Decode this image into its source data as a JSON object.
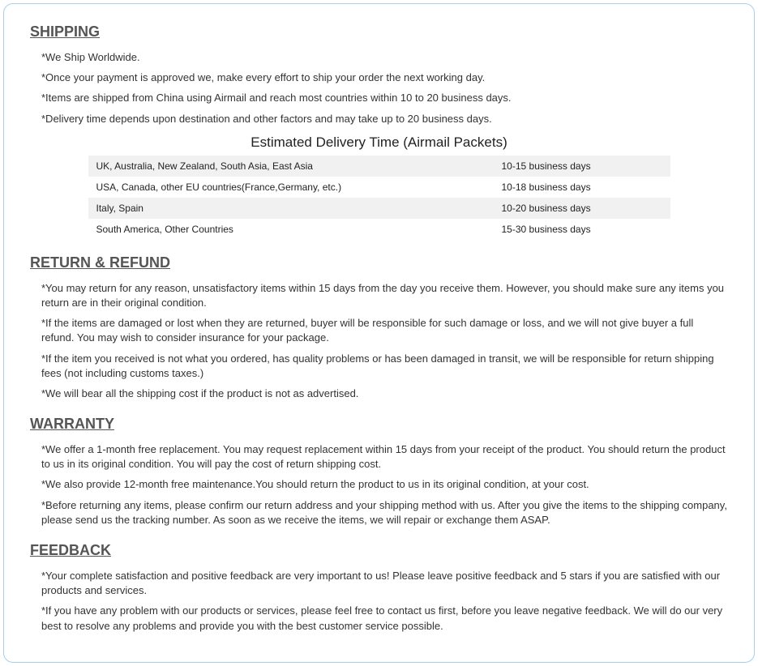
{
  "sections": {
    "shipping": {
      "title": "SHIPPING",
      "items": [
        "*We Ship Worldwide.",
        "*Once your payment is approved we, make every effort to ship your order the next working day.",
        "*Items are shipped from China using Airmail and reach most countries within 10 to 20 business days.",
        "*Delivery time depends upon destination and other factors and may take up to 20 business days."
      ],
      "table_title": "Estimated Delivery Time (Airmail Packets)",
      "table_rows": [
        {
          "region": "UK, Australia, New Zealand, South Asia, East Asia",
          "time": "10-15 business days"
        },
        {
          "region": "USA, Canada, other EU countries(France,Germany, etc.)",
          "time": "10-18 business days"
        },
        {
          "region": "Italy, Spain",
          "time": "10-20 business days"
        },
        {
          "region": "South America, Other Countries",
          "time": "15-30 business days"
        }
      ]
    },
    "return_refund": {
      "title": "RETURN & REFUND",
      "items": [
        "*You may return for any reason, unsatisfactory items within 15 days from the day you receive them. However, you should make sure any items you return are in their original condition.",
        "*If the items are damaged or lost when they are returned, buyer will be responsible for such damage or loss, and we will not give buyer a full refund. You may wish to consider insurance for your package.",
        "*If the item you received is not what you ordered, has quality problems or has been damaged in transit, we will be responsible for return shipping fees (not including customs taxes.)",
        "*We will bear all the shipping cost if the product is not as advertised."
      ]
    },
    "warranty": {
      "title": "WARRANTY",
      "items": [
        "*We offer a 1-month free replacement.  You may request replacement within 15 days from your receipt of the product. You should return the product to us in its original condition. You will pay the cost of return shipping cost.",
        "*We also provide 12-month free maintenance.You should return the product to us in its original condition, at your cost.",
        "*Before returning any items, please confirm our return address and your shipping method with us. After you give the items to the shipping company, please send us the tracking number. As soon as we receive the items, we will repair or exchange them ASAP."
      ]
    },
    "feedback": {
      "title": "FEEDBACK",
      "items": [
        "*Your complete satisfaction and positive feedback are very important to us!  Please leave positive feedback and 5 stars if you are satisfied with our products and services.",
        "*If you have any problem with our products or services, please feel free to contact us first, before you leave negative feedback.  We will do our very best to resolve any problems and provide you with the best customer service possible."
      ]
    }
  }
}
